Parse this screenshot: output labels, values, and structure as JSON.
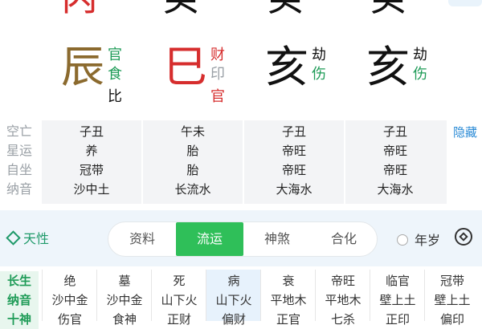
{
  "stems": [
    {
      "char": "丙",
      "color": "#d62d2d"
    },
    {
      "char": "癸",
      "color": "#111111"
    },
    {
      "char": "癸",
      "color": "#111111"
    },
    {
      "char": "癸",
      "color": "#111111"
    }
  ],
  "branches": [
    {
      "char": "辰",
      "color": "#8b6a2e",
      "gods": [
        {
          "t": "官",
          "c": "#1e9b57"
        },
        {
          "t": "食",
          "c": "#1e9b57"
        },
        {
          "t": "比",
          "c": "#111111"
        }
      ]
    },
    {
      "char": "巳",
      "color": "#d62d2d",
      "gods": [
        {
          "t": "财",
          "c": "#d62d2d"
        },
        {
          "t": "印",
          "c": "#9aa0a6"
        },
        {
          "t": "官",
          "c": "#d62d2d"
        }
      ]
    },
    {
      "char": "亥",
      "color": "#111111",
      "gods": [
        {
          "t": "劫",
          "c": "#111111"
        },
        {
          "t": "伤",
          "c": "#1e9b57"
        }
      ]
    },
    {
      "char": "亥",
      "color": "#111111",
      "gods": [
        {
          "t": "劫",
          "c": "#111111"
        },
        {
          "t": "伤",
          "c": "#1e9b57"
        }
      ]
    }
  ],
  "info": {
    "labels": [
      "空亡",
      "星运",
      "自坐",
      "纳音"
    ],
    "columns": [
      [
        "子丑",
        "养",
        "冠带",
        "沙中土"
      ],
      [
        "午未",
        "胎",
        "胎",
        "长流水"
      ],
      [
        "子丑",
        "帝旺",
        "帝旺",
        "大海水"
      ],
      [
        "子丑",
        "帝旺",
        "帝旺",
        "大海水"
      ]
    ],
    "hide_label": "隐藏"
  },
  "tabbar": {
    "tianxing": "天性",
    "tabs": [
      "资料",
      "流运",
      "神煞",
      "合化"
    ],
    "active_tab": "流运",
    "nianshui": "年岁"
  },
  "grid": {
    "labels": [
      "长生",
      "纳音",
      "十神"
    ],
    "columns": [
      [
        "绝",
        "沙中金",
        "伤官"
      ],
      [
        "墓",
        "沙中金",
        "食神"
      ],
      [
        "死",
        "山下火",
        "正财"
      ],
      [
        "病",
        "山下火",
        "偏财"
      ],
      [
        "衰",
        "平地木",
        "正官"
      ],
      [
        "帝旺",
        "平地木",
        "七杀"
      ],
      [
        "临官",
        "壁上土",
        "正印"
      ],
      [
        "冠带",
        "壁上土",
        "偏印"
      ]
    ]
  }
}
